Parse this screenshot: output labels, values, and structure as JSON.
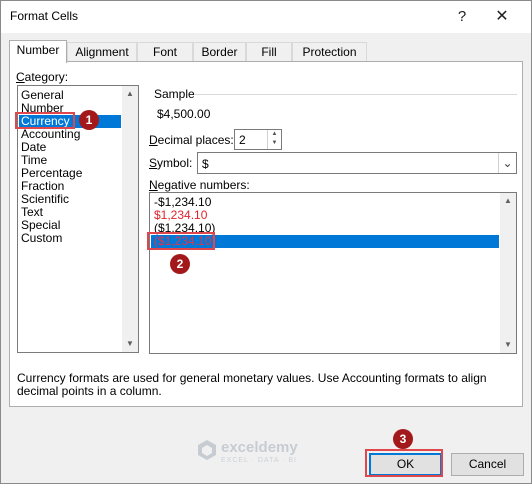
{
  "window": {
    "title": "Format Cells",
    "help_glyph": "?",
    "close_glyph": "✕"
  },
  "tabs": [
    {
      "label": "Number",
      "active": true
    },
    {
      "label": "Alignment"
    },
    {
      "label": "Font"
    },
    {
      "label": "Border"
    },
    {
      "label": "Fill"
    },
    {
      "label": "Protection"
    }
  ],
  "category": {
    "label_first": "C",
    "label_rest": "ategory:",
    "items": [
      "General",
      "Number",
      "Currency",
      "Accounting",
      "Date",
      "Time",
      "Percentage",
      "Fraction",
      "Scientific",
      "Text",
      "Special",
      "Custom"
    ],
    "selected": "Currency"
  },
  "sample": {
    "label": "Sample",
    "value": "$4,500.00"
  },
  "decimal_places": {
    "label_first": "D",
    "label_rest": "ecimal places:",
    "value": "2"
  },
  "symbol": {
    "label_first": "S",
    "label_rest": "ymbol:",
    "value": "$"
  },
  "negative_numbers": {
    "label_first": "N",
    "label_rest": "egative numbers:",
    "items": [
      {
        "text": "-$1,234.10",
        "red": false
      },
      {
        "text": "$1,234.10",
        "red": true
      },
      {
        "text": "($1,234.10)",
        "red": false
      },
      {
        "text": "($1,234.10)",
        "red": true
      }
    ],
    "selected_index": 3
  },
  "description": "Currency formats are used for general monetary values.  Use Accounting formats to align decimal points in a column.",
  "buttons": {
    "ok": "OK",
    "cancel": "Cancel"
  },
  "annotations": {
    "badges": [
      "1",
      "2",
      "3"
    ],
    "highlight_color": "#e0474c",
    "badge_color": "#a3191b"
  },
  "watermark": {
    "name": "exceldemy",
    "tagline": "EXCEL · DATA · BI"
  },
  "colors": {
    "selection": "#0078d7",
    "negative_red": "#e2232a"
  }
}
